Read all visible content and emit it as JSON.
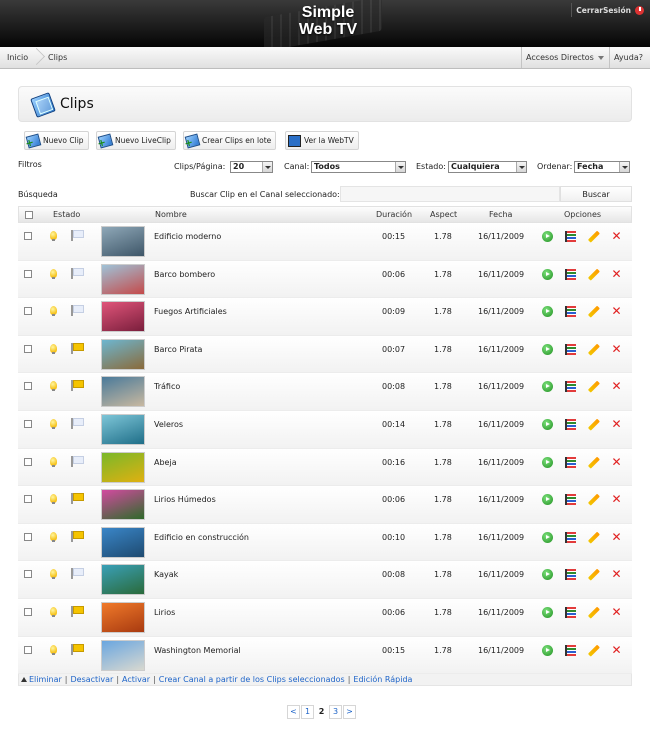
{
  "header": {
    "logo_line1": "Simple",
    "logo_line2": "Web TV",
    "logout": "CerrarSesión"
  },
  "nav": {
    "breadcrumb": [
      "Inicio",
      "Clips"
    ],
    "shortcuts": "Accesos Directos",
    "help": "Ayuda?"
  },
  "page_title": "Clips",
  "toolbar": [
    {
      "label": "Nuevo Clip",
      "icon": "film-plus-icon"
    },
    {
      "label": "Nuevo LiveClip",
      "icon": "film-plus-icon"
    },
    {
      "label": "Crear Clips en lote",
      "icon": "film-stack-plus-icon"
    },
    {
      "label": "Ver la WebTV",
      "icon": "monitor-icon"
    }
  ],
  "filters": {
    "label": "Filtros",
    "per_page_label": "Clips/Página:",
    "per_page_value": "20",
    "channel_label": "Canal:",
    "channel_value": "Todos",
    "status_label": "Estado:",
    "status_value": "Cualquiera",
    "order_label": "Ordenar:",
    "order_value": "Fecha"
  },
  "search": {
    "label": "Búsqueda",
    "field_label": "Buscar Clip en el Canal seleccionado:",
    "button": "Buscar"
  },
  "columns": {
    "status": "Estado",
    "name": "Nombre",
    "duration": "Duración",
    "aspect": "Aspect",
    "date": "Fecha",
    "options": "Opciones"
  },
  "rows": [
    {
      "name": "Edificio moderno",
      "duration": "00:15",
      "aspect": "1.78",
      "date": "16/11/2009",
      "flag": false,
      "thumb": [
        "#8fa8b8",
        "#3e5668"
      ]
    },
    {
      "name": "Barco bombero",
      "duration": "00:06",
      "aspect": "1.78",
      "date": "16/11/2009",
      "flag": false,
      "thumb": [
        "#9fc3d8",
        "#c44a4a"
      ]
    },
    {
      "name": "Fuegos Artificiales",
      "duration": "00:09",
      "aspect": "1.78",
      "date": "16/11/2009",
      "flag": false,
      "thumb": [
        "#e0557a",
        "#7a1e3c"
      ]
    },
    {
      "name": "Barco Pirata",
      "duration": "00:07",
      "aspect": "1.78",
      "date": "16/11/2009",
      "flag": true,
      "thumb": [
        "#6db6d0",
        "#8a6a3a"
      ]
    },
    {
      "name": "Tráfico",
      "duration": "00:08",
      "aspect": "1.78",
      "date": "16/11/2009",
      "flag": true,
      "thumb": [
        "#4a7a9a",
        "#c8b8a0"
      ]
    },
    {
      "name": "Veleros",
      "duration": "00:14",
      "aspect": "1.78",
      "date": "16/11/2009",
      "flag": false,
      "thumb": [
        "#7ec6d8",
        "#1f6e88"
      ]
    },
    {
      "name": "Abeja",
      "duration": "00:16",
      "aspect": "1.78",
      "date": "16/11/2009",
      "flag": false,
      "thumb": [
        "#7ab82a",
        "#e0b010"
      ]
    },
    {
      "name": "Lirios Húmedos",
      "duration": "00:06",
      "aspect": "1.78",
      "date": "16/11/2009",
      "flag": true,
      "thumb": [
        "#d34aa0",
        "#2e6a2a"
      ]
    },
    {
      "name": "Edificio en construcción",
      "duration": "00:10",
      "aspect": "1.78",
      "date": "16/11/2009",
      "flag": true,
      "thumb": [
        "#3a86c8",
        "#1e4a70"
      ]
    },
    {
      "name": "Kayak",
      "duration": "00:08",
      "aspect": "1.78",
      "date": "16/11/2009",
      "flag": false,
      "thumb": [
        "#3aa0b8",
        "#2a6a3a"
      ]
    },
    {
      "name": "Lirios",
      "duration": "00:06",
      "aspect": "1.78",
      "date": "16/11/2009",
      "flag": true,
      "thumb": [
        "#f07a2a",
        "#a83a10"
      ]
    },
    {
      "name": "Washington Memorial",
      "duration": "00:15",
      "aspect": "1.78",
      "date": "16/11/2009",
      "flag": true,
      "thumb": [
        "#6aa6e0",
        "#d8d8d0"
      ]
    }
  ],
  "bulk_actions": [
    "Eliminar",
    "Desactivar",
    "Activar",
    "Crear Canal a partir de los Clips seleccionados",
    "Edición Rápida"
  ],
  "pager": {
    "prev": "<",
    "pages": [
      "1",
      "2",
      "3"
    ],
    "current": "2",
    "next": ">"
  }
}
